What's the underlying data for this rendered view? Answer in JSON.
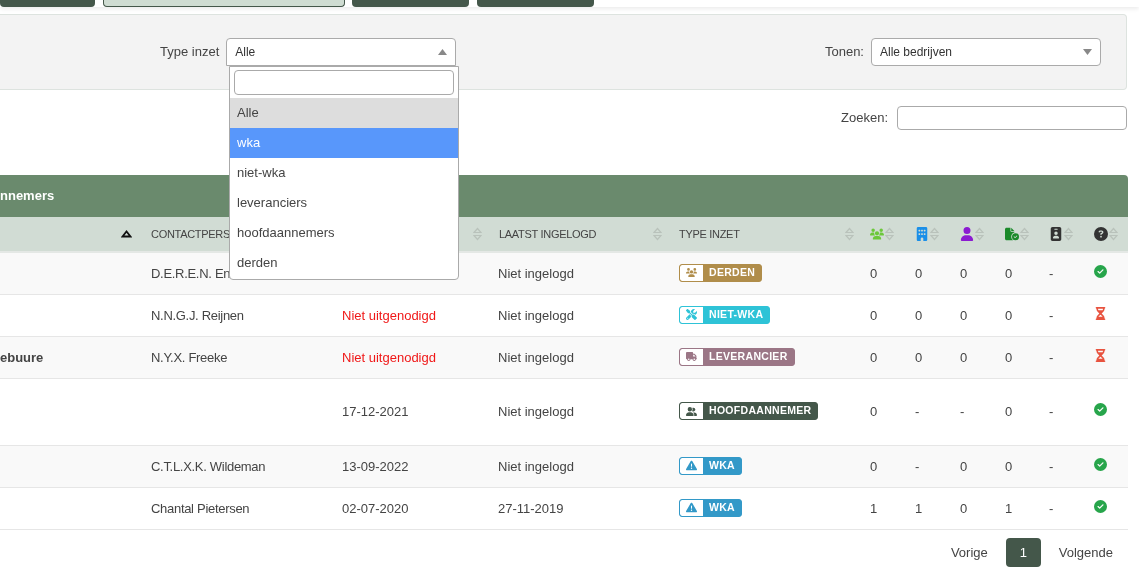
{
  "top_buttons": [
    {
      "selected": false
    },
    {
      "selected": true
    },
    {
      "selected": false
    },
    {
      "selected": false
    }
  ],
  "filters": [
    {
      "label": "Type inzet",
      "value": "Alle",
      "expanded": true
    },
    {
      "label": "Tonen:",
      "value": "Alle bedrijven",
      "expanded": false
    }
  ],
  "dropdown": {
    "options": [
      {
        "label": "Alle",
        "selected": true,
        "highlighted": false
      },
      {
        "label": "wka",
        "selected": false,
        "highlighted": true
      },
      {
        "label": "niet-wka",
        "selected": false,
        "highlighted": false
      },
      {
        "label": "leveranciers",
        "selected": false,
        "highlighted": false
      },
      {
        "label": "hoofdaannemers",
        "selected": false,
        "highlighted": false
      },
      {
        "label": "derden",
        "selected": false,
        "highlighted": false
      }
    ]
  },
  "search": {
    "label": "Zoeken:"
  },
  "table": {
    "title": "nnemers",
    "columns": [
      {
        "kind": "sort_asc"
      },
      {
        "kind": "text",
        "label": "CONTACTPERS",
        "sort_icon": false
      },
      {
        "kind": "text",
        "sort_icon": true
      },
      {
        "kind": "text",
        "label": "LAATST INGELOGD",
        "sort_icon": true
      },
      {
        "kind": "text",
        "label": "TYPE INZET",
        "sort_icon": true
      },
      {
        "kind": "workers"
      },
      {
        "kind": "building"
      },
      {
        "kind": "person"
      },
      {
        "kind": "file_check"
      },
      {
        "kind": "id_badge"
      },
      {
        "kind": "question"
      }
    ],
    "rows": [
      {
        "contact": "D.E.R.E.N. En",
        "last_login": "Niet ingelogd",
        "type": {
          "kind": "derden",
          "label": "DERDEN"
        },
        "counts": [
          "0",
          "0",
          "0",
          "0",
          "-"
        ],
        "approved": true
      },
      {
        "contact": "N.N.G.J. Reijnen",
        "invited": "Niet uitgenodigd",
        "warning": true,
        "last_login": "Niet ingelogd",
        "type": {
          "kind": "niet-wka",
          "label": "NIET-WKA"
        },
        "counts": [
          "0",
          "0",
          "0",
          "0",
          "-"
        ],
        "approved": false
      },
      {
        "name": "ebuure",
        "contact": "N.Y.X. Freeke",
        "invited": "Niet uitgenodigd",
        "warning": true,
        "last_login": "Niet ingelogd",
        "type": {
          "kind": "leverancier",
          "label": "LEVERANCIER"
        },
        "counts": [
          "0",
          "0",
          "0",
          "0",
          "-"
        ],
        "approved": false
      },
      {
        "invited": "17-12-2021",
        "warning": false,
        "last_login": "Niet ingelogd",
        "type": {
          "kind": "hoofdaannemer",
          "label": "HOOFDAANNEMER"
        },
        "counts": [
          "0",
          "-",
          "-",
          "0",
          "-"
        ],
        "approved": true
      },
      {
        "contact": "C.T.L.X.K. Wildeman",
        "invited": "13-09-2022",
        "warning": false,
        "last_login": "Niet ingelogd",
        "type": {
          "kind": "wka",
          "label": "WKA"
        },
        "counts": [
          "0",
          "-",
          "0",
          "0",
          "-"
        ],
        "approved": true
      },
      {
        "contact": "Chantal Pietersen",
        "invited": "02-07-2020",
        "warning": false,
        "last_login": "27-11-2019",
        "type": {
          "kind": "wka",
          "label": "WKA"
        },
        "counts": [
          "1",
          "1",
          "0",
          "1",
          "-"
        ],
        "approved": true
      }
    ]
  },
  "pagination": {
    "previous": "Vorige",
    "pages": [
      {
        "label": "1",
        "selected": true
      }
    ],
    "next": "Volgende"
  }
}
